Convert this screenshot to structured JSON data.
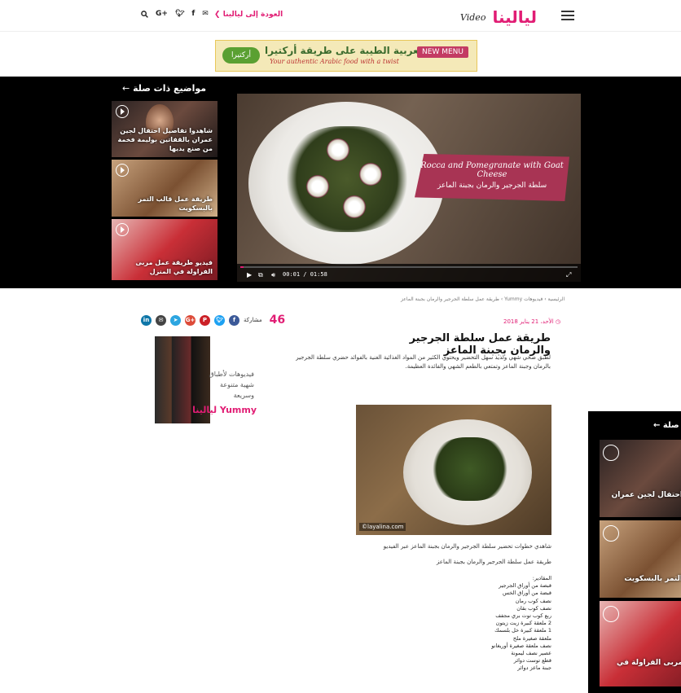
{
  "header": {
    "brand": "ليالينا",
    "brand_video": "Video",
    "back_link": "العودة إلى ليالينا",
    "social": [
      "G+",
      "f"
    ]
  },
  "ad_banner": {
    "arabic": "المطبخ العربية الطيبة على طريقة أركتيرا",
    "english": "Your authentic Arabic food with a twist",
    "badge": "NEW MENU",
    "logo": "أركتيرا"
  },
  "related": {
    "title": "مواضيع ذات صلة",
    "items": [
      {
        "label": "شاهدوا تفاصيل احتفال لجين عمران بالقفاتين بوليمة فخمة من صنع يديها"
      },
      {
        "label": "طريقة عمل قالب التمر بالبسكويت"
      },
      {
        "label": "فيديو طريقة عمل مربى الفراولة في المنزل"
      }
    ]
  },
  "player": {
    "overlay_en": "Rocca and Pomegranate with Goat Cheese",
    "overlay_ar": "سلطة الجرجير والرمان بجبنة الماعز",
    "time": "00:01 / 01:58",
    "progress": 0.01
  },
  "breadcrumb": "الرئيسية › فيديوهات Yummy › طريقة عمل سلطة الجرجير والرمان بجبنة الماعز",
  "article": {
    "date": "الأحد، 21 يناير 2018",
    "share_count": "46",
    "share_label": "مشاركة",
    "title": "طريقة عمل سلطة الجرجير والرمان بجبنة الماعز",
    "intro": "لطبق صحي شهي ولذيذ سهل التحضير ويحتوي الكثير من المواد الغذائية الغنية بالفوائد حضري سلطة الجرجير بالرمان وجبنة الماعز وتمتعي بالطعم الشهي والفائدة العظيمة.",
    "photo_watermark": "©layalina.com",
    "video_caption": "شاهدي خطوات تحضير سلطة الجرجير والرمان بجبنة الماعز عبر الفيديو",
    "subtitle": "طريقة عمل سلطة الجرجير والرمان بجبنة الماعز",
    "ingredients_title": "المقادير:",
    "ingredients": [
      "قبضة من أوراق الجرجير",
      "قبضة من أوراق الخس",
      "نصف كوب رمان",
      "نصف كوب بقان",
      "ربع كوب توت بري مجفف",
      "2 ملعقة كبيرة زيت زيتون",
      "1 ملعقة كبيرة خل بلسمك",
      "ملعقة صغيرة ملح",
      "نصف ملعقة صغيرة أوريغانو",
      "عصير نصف ليمونة",
      "قطع توست دوائر",
      "جبنة ماعز دوائر"
    ]
  },
  "side_ad": {
    "text": "فيديوهات لأطباق شهية متنوعة وسريعة",
    "brand": "ليالينا Yummy"
  },
  "sticky_related": {
    "title": "مواضيع ذات صلة",
    "items": [
      {
        "label": "احتفال لجين عمران"
      },
      {
        "label": "التمر بالبسكويت"
      },
      {
        "label": "مربى الفراولة في"
      }
    ]
  },
  "colors": {
    "accent": "#e11d74",
    "video_bg": "#000000",
    "tag": "#a83454"
  }
}
